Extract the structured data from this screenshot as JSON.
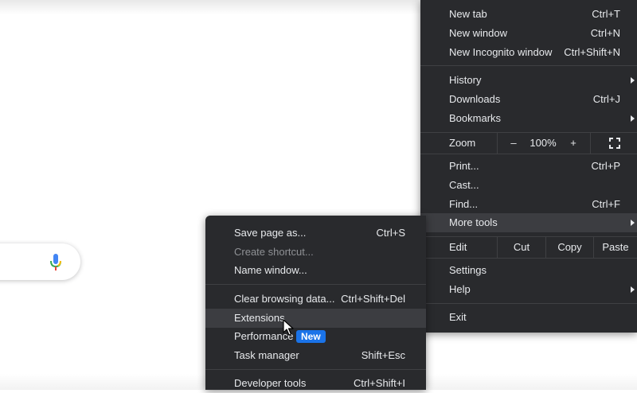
{
  "page": {
    "icons": {
      "mic": "microphone-icon",
      "cursor": "mouse-pointer-icon"
    },
    "colors": {
      "menu_bg": "#292a2d",
      "menu_text": "#e8eaed",
      "badge": "#1a73e8"
    }
  },
  "main_menu": {
    "new_tab": {
      "label": "New tab",
      "shortcut": "Ctrl+T"
    },
    "new_window": {
      "label": "New window",
      "shortcut": "Ctrl+N"
    },
    "new_incognito": {
      "label": "New Incognito window",
      "shortcut": "Ctrl+Shift+N"
    },
    "history": {
      "label": "History"
    },
    "downloads": {
      "label": "Downloads",
      "shortcut": "Ctrl+J"
    },
    "bookmarks": {
      "label": "Bookmarks"
    },
    "zoom": {
      "label": "Zoom",
      "minus": "–",
      "value": "100%",
      "plus": "+",
      "fullscreen_icon": "fullscreen-icon"
    },
    "print": {
      "label": "Print...",
      "shortcut": "Ctrl+P"
    },
    "cast": {
      "label": "Cast..."
    },
    "find": {
      "label": "Find...",
      "shortcut": "Ctrl+F"
    },
    "more_tools": {
      "label": "More tools"
    },
    "edit": {
      "label": "Edit",
      "cut": "Cut",
      "copy": "Copy",
      "paste": "Paste"
    },
    "settings": {
      "label": "Settings"
    },
    "help": {
      "label": "Help"
    },
    "exit": {
      "label": "Exit"
    }
  },
  "more_tools_menu": {
    "save_page": {
      "label": "Save page as...",
      "shortcut": "Ctrl+S"
    },
    "create_shortcut": {
      "label": "Create shortcut..."
    },
    "name_window": {
      "label": "Name window..."
    },
    "clear_browsing": {
      "label": "Clear browsing data...",
      "shortcut": "Ctrl+Shift+Del"
    },
    "extensions": {
      "label": "Extensions"
    },
    "performance": {
      "label": "Performance",
      "badge": "New"
    },
    "task_manager": {
      "label": "Task manager",
      "shortcut": "Shift+Esc"
    },
    "developer_tools": {
      "label": "Developer tools",
      "shortcut": "Ctrl+Shift+I"
    }
  }
}
